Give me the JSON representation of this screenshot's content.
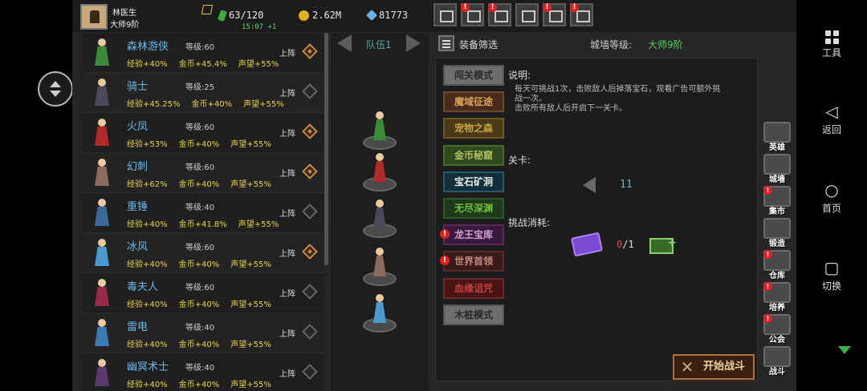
{
  "player": {
    "name": "林医生",
    "rank": "大师9阶"
  },
  "resources": {
    "energy": "63/120",
    "energy_timer": "15:07 +1",
    "gold": "2.62M",
    "gems": "81773"
  },
  "top_icons": [
    {
      "name": "shop-icon",
      "alert": false
    },
    {
      "name": "mail-icon",
      "alert": true
    },
    {
      "name": "quest-icon",
      "alert": true
    },
    {
      "name": "settings-icon",
      "alert": false
    },
    {
      "name": "rank-icon",
      "alert": true
    },
    {
      "name": "event-icon",
      "alert": true
    }
  ],
  "heroes": [
    {
      "name": "森林游侠",
      "level_label": "等级:60",
      "exp": "经验+40%",
      "gold": "金币+45.4%",
      "fame": "声望+55%",
      "deploy": "上阵",
      "deployed": true,
      "color": "#3a8a3a"
    },
    {
      "name": "骑士",
      "level_label": "等级:25",
      "exp": "经验+45.25%",
      "gold": "金币+40%",
      "fame": "声望+55%",
      "deploy": "上阵",
      "deployed": false,
      "color": "#4a4a5a"
    },
    {
      "name": "火凤",
      "level_label": "等级:60",
      "exp": "经验+53%",
      "gold": "金币+40%",
      "fame": "声望+55%",
      "deploy": "上阵",
      "deployed": true,
      "color": "#b02a2a"
    },
    {
      "name": "幻刺",
      "level_label": "等级:60",
      "exp": "经验+62%",
      "gold": "金币+40%",
      "fame": "声望+55%",
      "deploy": "上阵",
      "deployed": true,
      "color": "#8a6a5a"
    },
    {
      "name": "重锤",
      "level_label": "等级:40",
      "exp": "经验+40%",
      "gold": "金币+41.8%",
      "fame": "声望+55%",
      "deploy": "上阵",
      "deployed": false,
      "color": "#3a6a9a"
    },
    {
      "name": "冰风",
      "level_label": "等级:60",
      "exp": "经验+40%",
      "gold": "金币+40%",
      "fame": "声望+55%",
      "deploy": "上阵",
      "deployed": true,
      "color": "#4a9ad0"
    },
    {
      "name": "毒夫人",
      "level_label": "等级:60",
      "exp": "经验+40%",
      "gold": "金币+40%",
      "fame": "声望+55%",
      "deploy": "上阵",
      "deployed": false,
      "color": "#9a2a4a"
    },
    {
      "name": "雷电",
      "level_label": "等级:40",
      "exp": "经验+40%",
      "gold": "金币+40%",
      "fame": "声望+55%",
      "deploy": "上阵",
      "deployed": false,
      "color": "#3a7ab0"
    },
    {
      "name": "幽冥术士",
      "level_label": "等级:40",
      "exp": "经验+40%",
      "gold": "金币+40%",
      "fame": "声望+55%",
      "deploy": "上阵",
      "deployed": false,
      "color": "#5a3a6a"
    }
  ],
  "team": {
    "name": "队伍1",
    "members": [
      {
        "name": "forest-ranger",
        "color": "#3a8a3a"
      },
      {
        "name": "fire-phoenix",
        "color": "#b02a2a"
      },
      {
        "name": "knight",
        "color": "#4a4a5a"
      },
      {
        "name": "phantom-assassin",
        "color": "#8a6a5a"
      },
      {
        "name": "ice-wind",
        "color": "#4a9ad0"
      }
    ]
  },
  "equip_filter": "装备筛选",
  "wall": {
    "label": "城墙等级:",
    "value": "大师9阶"
  },
  "modes": [
    {
      "label": "闯关模式",
      "style": "gray",
      "alert": false
    },
    {
      "label": "魔域征途",
      "style": "brown",
      "alert": false
    },
    {
      "label": "宠物之森",
      "style": "olive",
      "alert": false
    },
    {
      "label": "金币秘窟",
      "style": "green",
      "alert": false
    },
    {
      "label": "宝石矿洞",
      "style": "teal",
      "alert": false
    },
    {
      "label": "无尽深渊",
      "style": "dgreen",
      "alert": false
    },
    {
      "label": "龙王宝库",
      "style": "purple",
      "alert": true
    },
    {
      "label": "世界首领",
      "style": "maroon",
      "alert": true
    },
    {
      "label": "血缘诅咒",
      "style": "red",
      "alert": false
    },
    {
      "label": "木桩模式",
      "style": "gray",
      "alert": false
    }
  ],
  "description": {
    "title": "说明:",
    "text": "每天可挑战1次，击败敌人后掉落宝石，观看广告可额外挑战一次。\n击败所有敌人后开启下一关卡。"
  },
  "stage": {
    "title": "关卡:",
    "value": "11"
  },
  "cost": {
    "title": "挑战消耗:",
    "have": "0",
    "max": "/1"
  },
  "start_button": "开始战斗",
  "side_menu": [
    {
      "label": "英雄",
      "icon": "hero-icon",
      "alert": false
    },
    {
      "label": "城墙",
      "icon": "wall-icon",
      "alert": false
    },
    {
      "label": "集市",
      "icon": "market-icon",
      "alert": true
    },
    {
      "label": "锻造",
      "icon": "forge-icon",
      "alert": false
    },
    {
      "label": "仓库",
      "icon": "warehouse-icon",
      "alert": true
    },
    {
      "label": "培养",
      "icon": "train-icon",
      "alert": true
    },
    {
      "label": "公会",
      "icon": "guild-icon",
      "alert": true
    },
    {
      "label": "战斗",
      "icon": "battle-icon",
      "alert": false
    }
  ],
  "android_nav": [
    {
      "label": "工具",
      "icon": "tools-icon"
    },
    {
      "label": "返回",
      "icon": "back-icon"
    },
    {
      "label": "首页",
      "icon": "home-icon"
    },
    {
      "label": "切换",
      "icon": "switch-icon"
    }
  ]
}
